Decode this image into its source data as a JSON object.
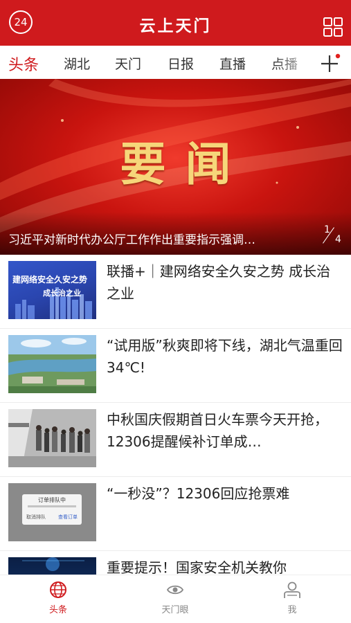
{
  "header": {
    "badge": "24",
    "title": "云上天门"
  },
  "tabs": [
    {
      "label": "头条",
      "active": true
    },
    {
      "label": "湖北",
      "active": false
    },
    {
      "label": "天门",
      "active": false
    },
    {
      "label": "日报",
      "active": false
    },
    {
      "label": "直播",
      "active": false
    },
    {
      "label": "点播",
      "active": false
    }
  ],
  "banner": {
    "title": "要闻",
    "caption": "习近平对新时代办公厅工作作出重要指示强调…",
    "page_current": "1",
    "page_total": "4"
  },
  "news": [
    {
      "title": "联播+｜建网络安全久安之势 成长治之业",
      "thumb_text_1": "建网络安全久安之势",
      "thumb_text_2": "成长治之业"
    },
    {
      "title": "“试用版”秋爽即将下线，湖北气温重回34℃!"
    },
    {
      "title": "中秋国庆假期首日火车票今天开抢，12306提醒候补订单成…"
    },
    {
      "title": "“一秒没”？12306回应抢票难",
      "thumb_dialog_title": "订单排队中",
      "thumb_dialog_btn_1": "取消排队",
      "thumb_dialog_btn_2": "查看订单"
    },
    {
      "title": "重要提示！国家安全机关教你"
    }
  ],
  "bottom_nav": [
    {
      "label": "头条",
      "icon": "globe-icon",
      "active": true
    },
    {
      "label": "天门眼",
      "icon": "eye-icon",
      "active": false
    },
    {
      "label": "我",
      "icon": "user-icon",
      "active": false
    }
  ],
  "colors": {
    "brand_red": "#cf1a1d",
    "banner_gold": "#f6d67a"
  }
}
